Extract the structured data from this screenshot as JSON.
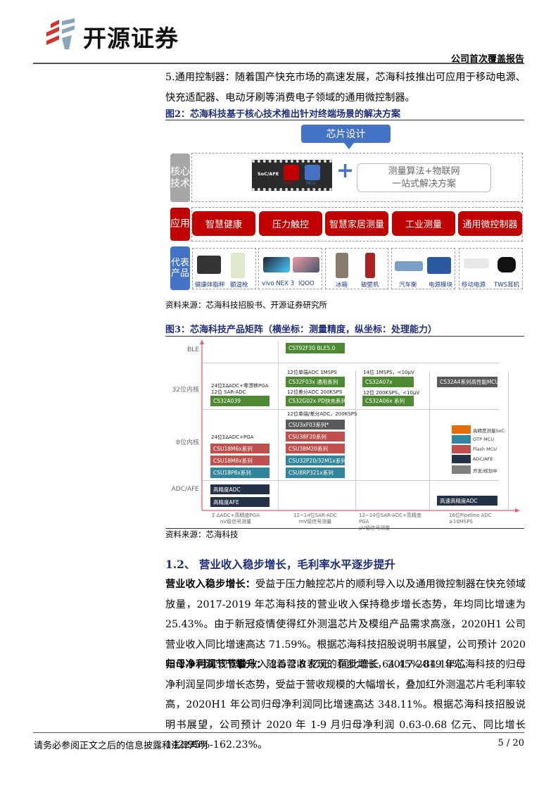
{
  "header": {
    "brand": "开源证券",
    "report_type": "公司首次覆盖报告"
  },
  "intro_paragraph": "5.通用控制器：随着国产快充市场的高速发展，芯海科技推出可应用于移动电源、快充适配器、电动牙刷等消费电子领域的通用微控制器。",
  "figure2": {
    "title": "图2：芯海科技基于核心技术推出针对终端场景的解决方案",
    "top_box": "芯片设计",
    "row_labels": [
      "核心技术",
      "应用",
      "代表产品"
    ],
    "chip": {
      "label": "SoC/AFE",
      "adc": "ADC",
      "mcu": "MCU"
    },
    "plus": "+",
    "solution": [
      "测量算法+物联网",
      "一站式解决方案"
    ],
    "applications": [
      "智慧健康",
      "压力触控",
      "智慧家居测量",
      "工业测量",
      "通用微控制器"
    ],
    "products": [
      [
        "健康体脂秤",
        "额温枪"
      ],
      [
        "vivo NEX 3",
        "IQOO"
      ],
      [
        "冰箱",
        "破壁机"
      ],
      [
        "汽车衡",
        "电源模块"
      ],
      [
        "移动电源",
        "TWS耳机"
      ]
    ],
    "source": "资料来源：芯海科技招股书、开源证券研究所"
  },
  "figure3": {
    "title": "图3：芯海科技产品矩阵（横坐标：测量精度，纵坐标：处理能力）",
    "y_labels": [
      "BLE",
      "32位内核",
      "8位内核",
      "ADC/AFE"
    ],
    "x_labels": [
      [
        "Σ ΔADC+高精度PGA",
        "nV级信号测量"
      ],
      [
        "12~14位SAR-ADC",
        "mV级信号测量"
      ],
      [
        "12~14位SAR-ADC+高精度PGA",
        "μV级信号测量"
      ],
      [
        "16位Pipeline ADC",
        "≥10MSPS"
      ]
    ],
    "annotations": [
      "24位ΣΔADC+零漂移PGA",
      "12位 SAR-ADC",
      "12位单端ADC 1MSPS",
      "12位差分ADC 200KSPS",
      "14位 1MSPS，<10μV",
      "12位 200KSPS，<10μV",
      "12位单端/差分ADC，200KSPS",
      "24位ΣΔADC+PGA"
    ],
    "products": [
      "CST92F30 BLE5.0",
      "CS32F03x 通用系列",
      "CS32G02x PD快充系列",
      "CS32A07x",
      "CS32A06x 系列",
      "CS32A4系列高性能MCU",
      "CS32A039",
      "CSU3xF03系列*",
      "CSU38F20系列",
      "CSU38M20系列",
      "CSU32P20/32M1x系列",
      "CSU8RP321x系列",
      "CSU18M6x系列",
      "CSU18M8x系列",
      "CSU18P8x系列",
      "高精度ADC",
      "高精度AFE",
      "高速高精度ADC"
    ],
    "legend": [
      "高精度测量SoC",
      "OTP MCU",
      "Flash MCU",
      "ADC/AFE",
      "开发/规划中"
    ],
    "colors": {
      "soc": "#e46c0a",
      "otp": "#31859c",
      "flash": "#c0504d",
      "adc": "#243248",
      "dev": "#595959",
      "green": "#4e8a34"
    },
    "source": "资料来源：芯海科技"
  },
  "section": {
    "title": "1.2、 营业收入稳步增长，毛利率水平逐步提升"
  },
  "para1": {
    "lead": "营业收入稳步增长：",
    "text": "受益于压力触控芯片的顺利导入以及通用微控制器在快充领域放量，2017-2019 年芯海科技的营业收入保持稳步增长态势，年均同比增速为 25.43%。由于新冠疫情使得红外测温芯片及模组产品需求高涨，2020H1 公司营业收入同比增速高达 71.59%。根据芯海科技招股说明书展望，公司预计 2020 年 1-9 月实现营业收入 2.5-2.8 亿元、同比增长 64.45%-84.19%。"
  },
  "para2": {
    "lead": "归母净利润节节攀升：",
    "text": "随着营收表现的稳步增长，2017-2019 年芯海科技的归母净利润呈同步增长态势，受益于营收规模的大幅增长，叠加红外测温芯片毛利率较高，2020H1 年公司归母净利润同比增速高达 348.11%。根据芯海科技招股说明书展望，公司预计 2020 年 1-9 月归母净利润 0.63-0.68 亿元、同比增长 142.95%-162.23%。"
  },
  "footer": {
    "disclaimer": "请务必参阅正文之后的信息披露和法律声明",
    "page": "5 / 20"
  }
}
